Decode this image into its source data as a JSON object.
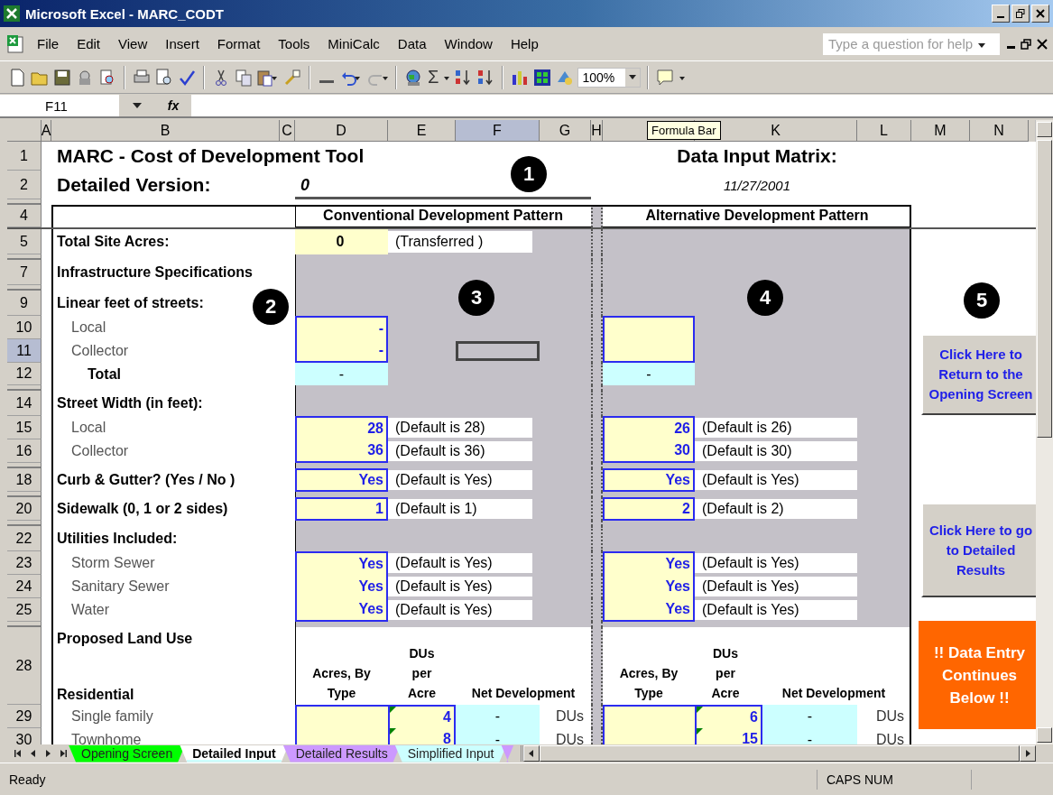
{
  "window": {
    "title": "Microsoft Excel - MARC_CODT"
  },
  "menu": [
    "File",
    "Edit",
    "View",
    "Insert",
    "Format",
    "Tools",
    "MiniCalc",
    "Data",
    "Window",
    "Help"
  ],
  "help_box": {
    "placeholder": "Type a question for help"
  },
  "toolbar": {
    "autosum": "Σ",
    "zoom": "100%"
  },
  "formula_bar": {
    "name_box": "F11",
    "fx": "fx"
  },
  "tooltip": "Formula Bar",
  "columns": [
    {
      "label": "A",
      "selected": false
    },
    {
      "label": "B",
      "selected": false
    },
    {
      "label": "C",
      "selected": false
    },
    {
      "label": "D",
      "selected": false
    },
    {
      "label": "E",
      "selected": false
    },
    {
      "label": "F",
      "selected": true
    },
    {
      "label": "G",
      "selected": false
    },
    {
      "label": "H",
      "selected": false
    },
    {
      "label": "K",
      "selected": false
    },
    {
      "label": "L",
      "selected": false
    },
    {
      "label": "M",
      "selected": false
    },
    {
      "label": "N",
      "selected": false
    }
  ],
  "rows": [
    {
      "number": "1",
      "kind": "title",
      "selected": false,
      "label": "MARC - Cost of Development Tool",
      "right": "Data Input Matrix:"
    },
    {
      "number": "2",
      "kind": "subtitle",
      "selected": false,
      "label": "Detailed Version:",
      "value": "0",
      "right": "11/27/2001"
    },
    {
      "kind": "hidden"
    },
    {
      "number": "4",
      "kind": "header",
      "selected": false,
      "conventional": "Conventional Development Pattern",
      "alternative": "Alternative Development Pattern"
    },
    {
      "number": "5",
      "kind": "site",
      "selected": false,
      "label": "Total Site Acres:",
      "conventional": {
        "value": "0",
        "note": "(Transferred )"
      }
    },
    {
      "kind": "hidden"
    },
    {
      "number": "7",
      "kind": "heading",
      "selected": false,
      "label": "Infrastructure Specifications"
    },
    {
      "kind": "hidden"
    },
    {
      "number": "9",
      "kind": "heading",
      "selected": false,
      "label": "Linear feet of streets:"
    },
    {
      "number": "10",
      "kind": "input",
      "selected": false,
      "indented": true,
      "label": "Local",
      "conventional": {
        "value": "-"
      },
      "alternative": {}
    },
    {
      "number": "11",
      "kind": "input",
      "selected": true,
      "indented": true,
      "label": "Collector",
      "conventional": {
        "value": "-"
      },
      "alternative": {}
    },
    {
      "number": "12",
      "kind": "total",
      "selected": false,
      "label": "Total",
      "conventional": {
        "value": "-"
      },
      "alternative": {
        "value": "-"
      }
    },
    {
      "kind": "hidden"
    },
    {
      "number": "14",
      "kind": "heading",
      "selected": false,
      "label": "Street Width (in feet):"
    },
    {
      "number": "15",
      "kind": "input",
      "selected": false,
      "indented": true,
      "label": "Local",
      "conventional": {
        "value": "28",
        "note": "(Default is 28)"
      },
      "alternative": {
        "value": "26",
        "note": "(Default is 26)"
      }
    },
    {
      "number": "16",
      "kind": "input",
      "selected": false,
      "indented": true,
      "label": "Collector",
      "conventional": {
        "value": "36",
        "note": "(Default is 36)"
      },
      "alternative": {
        "value": "30",
        "note": "(Default is 30)"
      }
    },
    {
      "kind": "hidden"
    },
    {
      "number": "18",
      "kind": "input",
      "selected": false,
      "indented": false,
      "label": "Curb & Gutter? (Yes / No )",
      "conventional": {
        "value": "Yes",
        "note": "(Default is Yes)"
      },
      "alternative": {
        "value": "Yes",
        "note": "(Default is Yes)"
      }
    },
    {
      "kind": "hidden"
    },
    {
      "number": "20",
      "kind": "input",
      "selected": false,
      "indented": false,
      "label": "Sidewalk (0, 1 or 2 sides)",
      "conventional": {
        "value": "1",
        "note": "(Default is 1)"
      },
      "alternative": {
        "value": "2",
        "note": "(Default is 2)"
      }
    },
    {
      "kind": "hidden"
    },
    {
      "number": "22",
      "kind": "heading",
      "selected": false,
      "label": "Utilities Included:"
    },
    {
      "number": "23",
      "kind": "input",
      "selected": false,
      "indented": true,
      "label": "Storm Sewer",
      "conventional": {
        "value": "Yes",
        "note": "(Default is Yes)"
      },
      "alternative": {
        "value": "Yes",
        "note": "(Default is Yes)"
      }
    },
    {
      "number": "24",
      "kind": "input",
      "selected": false,
      "indented": true,
      "label": "Sanitary Sewer",
      "conventional": {
        "value": "Yes",
        "note": "(Default is Yes)"
      },
      "alternative": {
        "value": "Yes",
        "note": "(Default is Yes)"
      }
    },
    {
      "number": "25",
      "kind": "input",
      "selected": false,
      "indented": true,
      "label": "Water",
      "conventional": {
        "value": "Yes",
        "note": "(Default is Yes)"
      },
      "alternative": {
        "value": "Yes",
        "note": "(Default is Yes)"
      }
    },
    {
      "kind": "hidden"
    },
    {
      "number": "28",
      "kind": "landuse_head",
      "selected": false,
      "label": "Proposed Land Use",
      "sublabel": "Residential",
      "conventional_columns": [
        "Acres, By\nType",
        "DUs\nper\nAcre",
        "Net Development"
      ],
      "alternative_columns": [
        "Acres, By\nType",
        "DUs\nper\nAcre",
        "Net Development"
      ]
    },
    {
      "number": "29",
      "kind": "landuse",
      "selected": false,
      "label": "Single family",
      "conventional": {
        "density": "4",
        "net": "-",
        "unit": "DUs"
      },
      "alternative": {
        "density": "6",
        "net": "-",
        "unit": "DUs"
      }
    },
    {
      "number": "30",
      "kind": "landuse",
      "selected": false,
      "label": "Townhome",
      "conventional": {
        "density": "8",
        "net": "-",
        "unit": "DUs"
      },
      "alternative": {
        "density": "15",
        "net": "-",
        "unit": "DUs"
      }
    }
  ],
  "callouts": [
    "1",
    "2",
    "3",
    "4",
    "5"
  ],
  "side_buttons": [
    {
      "kind": "button",
      "label": "Click Here to Return to the Opening Screen"
    },
    {
      "kind": "button",
      "label": "Click Here to go to Detailed Results"
    },
    {
      "kind": "notice",
      "label": "!! Data Entry Continues Below !!"
    }
  ],
  "sheet_tabs": [
    {
      "label": "Opening Screen",
      "color": "#00ff00",
      "selected": false
    },
    {
      "label": "Detailed Input",
      "color": "#ccffff",
      "selected": true
    },
    {
      "label": "Detailed Results",
      "color": "#cc99ff",
      "selected": false
    },
    {
      "label": "Simplified Input",
      "color": "#ccffff",
      "selected": false
    },
    {
      "color": "#cc99ff",
      "selected": false
    }
  ],
  "status": {
    "text": "Ready",
    "indicators": "CAPS NUM"
  }
}
